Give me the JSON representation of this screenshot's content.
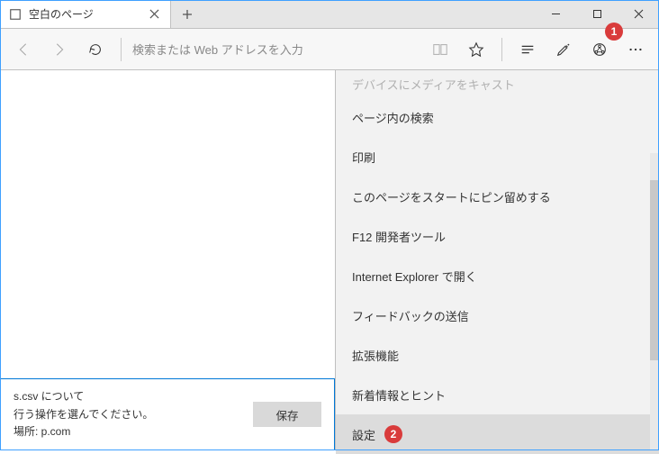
{
  "tab": {
    "title": "空白のページ"
  },
  "address": {
    "placeholder": "検索または Web アドレスを入力"
  },
  "menu": {
    "items": [
      {
        "label": "デバイスにメディアをキャスト",
        "disabled": true
      },
      {
        "label": "ページ内の検索"
      },
      {
        "label": "印刷"
      },
      {
        "label": "このページをスタートにピン留めする"
      },
      {
        "label": "F12 開発者ツール"
      },
      {
        "label": "Internet Explorer で開く"
      },
      {
        "label": "フィードバックの送信"
      },
      {
        "label": "拡張機能"
      },
      {
        "label": "新着情報とヒント"
      },
      {
        "label": "設定",
        "hovered": true
      }
    ]
  },
  "download": {
    "line1": "s.csv について",
    "line2": "行う操作を選んでください。",
    "line3": "場所: p.com",
    "save_label": "保存"
  },
  "annotations": {
    "badge1": "1",
    "badge2": "2"
  }
}
